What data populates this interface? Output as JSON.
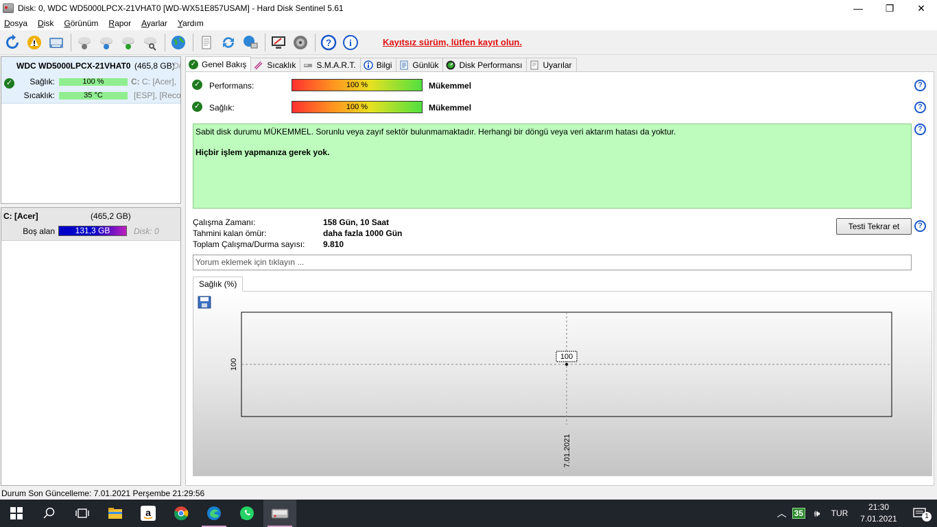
{
  "window": {
    "title": "Disk: 0, WDC WD5000LPCX-21VHAT0 [WD-WX51E857USAM]  -  Hard Disk Sentinel 5.61",
    "minimize": "—",
    "maximize": "❐",
    "close": "✕"
  },
  "menu": [
    "Dosya",
    "Disk",
    "Görünüm",
    "Rapor",
    "Ayarlar",
    "Yardım"
  ],
  "toolbar": {
    "register_text": "Kayıtsız sürüm, lütfen kayıt olun."
  },
  "disk_panel": {
    "name": "WDC WD5000LPCX-21VHAT0",
    "size": "(465,8 GB)",
    "extra": "Di",
    "health_label": "Sağlık:",
    "health_value": "100 %",
    "health_fraction": 1.0,
    "temp_label": "Sıcaklık:",
    "temp_value": "35 °C",
    "partition_1": "C: [Acer],",
    "partition_2": "[ESP], [Reco"
  },
  "partition_panel": {
    "name": "C: [Acer]",
    "size": "(465,2 GB)",
    "free_label": "Boş alan",
    "free_value": "131,3 GB",
    "disk_ref": "Disk: 0"
  },
  "tabs": [
    {
      "label": "Genel Bakış",
      "icon": "check-icon"
    },
    {
      "label": "Sıcaklık",
      "icon": "thermometer-icon"
    },
    {
      "label": "S.M.A.R.T.",
      "icon": "drive-icon"
    },
    {
      "label": "Bilgi",
      "icon": "info-icon"
    },
    {
      "label": "Günlük",
      "icon": "log-icon"
    },
    {
      "label": "Disk Performansı",
      "icon": "gauge-icon"
    },
    {
      "label": "Uyarılar",
      "icon": "document-icon"
    }
  ],
  "overview": {
    "performance_label": "Performans:",
    "performance_value": "100 %",
    "performance_status": "Mükemmel",
    "health_label": "Sağlık:",
    "health_value": "100 %",
    "health_status": "Mükemmel",
    "message_line1": "Sabit disk durumu MÜKEMMEL. Sorunlu veya zayıf sektör bulunmamaktadır. Herhangi bir döngü veya veri aktarım hatası da yoktur.",
    "message_line2": "Hiçbir işlem yapmanıza gerek yok.",
    "uptime_label": "Çalışma Zamanı:",
    "uptime_value": "158 Gün, 10 Saat",
    "remaining_label": "Tahmini kalan ömür:",
    "remaining_value": "daha fazla 1000 Gün",
    "cycles_label": "Toplam Çalışma/Durma sayısı:",
    "cycles_value": "9.810",
    "retest_button": "Testi Tekrar et",
    "comment_placeholder": "Yorum eklemek için tıklayın ...",
    "help": "?"
  },
  "chart_tab_label": "Sağlık (%)",
  "chart_data": {
    "type": "line",
    "x": [
      "7.01.2021"
    ],
    "y": [
      100
    ],
    "ytick_labels": [
      "100"
    ],
    "xtick_labels": [
      "7.01.2021"
    ],
    "point_labels": [
      "100"
    ],
    "grid": true
  },
  "status_bar": "Durum Son Güncelleme: 7.01.2021 Perşembe 21:29:56",
  "taskbar": {
    "tray_badge": "35",
    "language": "TUR",
    "time": "21:30",
    "date": "7.01.2021",
    "notifications": "1"
  }
}
